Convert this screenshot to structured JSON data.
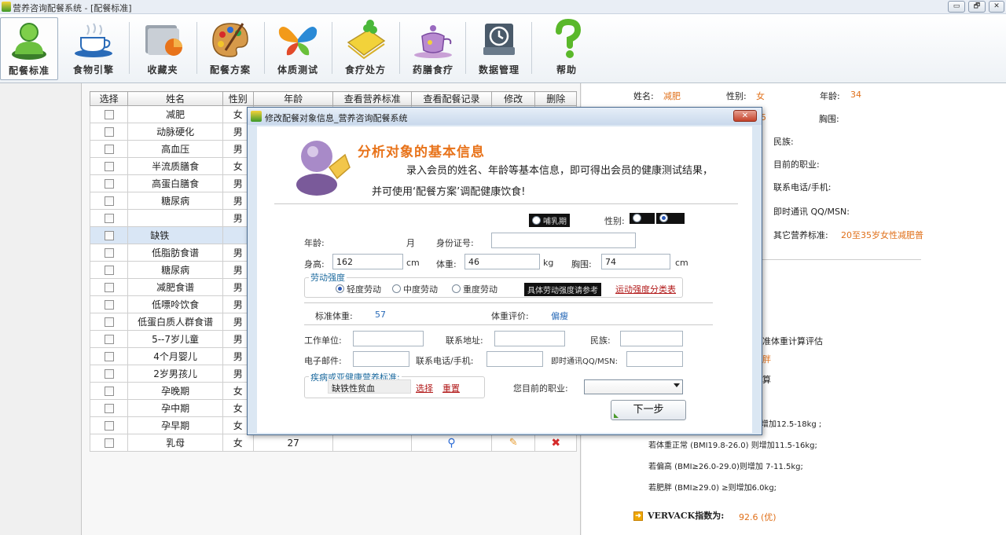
{
  "window": {
    "title": "营养咨询配餐系统 - [配餐标准]",
    "buttons": [
      "▭",
      "🗗",
      "✕"
    ]
  },
  "toolbar": {
    "items": [
      {
        "label": "配餐标准",
        "icon": "person-icon"
      },
      {
        "label": "食物引擎",
        "icon": "coffee-cup-icon"
      },
      {
        "label": "收藏夹",
        "icon": "folder-icon"
      },
      {
        "label": "配餐方案",
        "icon": "palette-icon"
      },
      {
        "label": "体质测试",
        "icon": "butterfly-icon"
      },
      {
        "label": "食疗处方",
        "icon": "notebook-clover-icon"
      },
      {
        "label": "药膳食疗",
        "icon": "teapot-icon"
      },
      {
        "label": "数据管理",
        "icon": "backup-drive-icon"
      },
      {
        "label": "帮助",
        "icon": "question-mark-icon"
      }
    ]
  },
  "grid": {
    "columns": [
      "选择",
      "姓名",
      "性别",
      "年龄",
      "查看营养标准",
      "查看配餐记录",
      "修改",
      "删除"
    ],
    "rows": [
      {
        "name": "减肥",
        "gender": "女"
      },
      {
        "name": "动脉硬化",
        "gender": "男"
      },
      {
        "name": "高血压",
        "gender": "男"
      },
      {
        "name": "半流质膳食",
        "gender": "女"
      },
      {
        "name": "高蛋白膳食",
        "gender": "男"
      },
      {
        "name": "糖尿病",
        "gender": "男"
      },
      {
        "name": "",
        "gender": "男"
      },
      {
        "name": "缺铁",
        "gender": ""
      },
      {
        "name": "低脂肪食谱",
        "gender": "男"
      },
      {
        "name": "糖尿病",
        "gender": "男"
      },
      {
        "name": "减肥食谱",
        "gender": "男"
      },
      {
        "name": "低嘌呤饮食",
        "gender": "男"
      },
      {
        "name": "低蛋白质人群食谱",
        "gender": "男"
      },
      {
        "name": "5--7岁儿童",
        "gender": "男"
      },
      {
        "name": "4个月婴儿",
        "gender": "男"
      },
      {
        "name": "2岁男孩儿",
        "gender": "男"
      },
      {
        "name": "孕晚期",
        "gender": "女"
      },
      {
        "name": "孕中期",
        "gender": "女"
      },
      {
        "name": "孕早期",
        "gender": "女"
      },
      {
        "name": "乳母",
        "gender": "女",
        "age": "27"
      }
    ]
  },
  "right": {
    "name_label": "姓名:",
    "name_value": "减肥",
    "gender_label": "性别:",
    "gender_value": "女",
    "age_label": "年龄:",
    "age_value": "34",
    "partial_value": "5",
    "chest_label": "胸围:",
    "ethnicity_label": "民族:",
    "occupation_label": "目前的职业:",
    "phone_label": "联系电话/手机:",
    "im_label": "即时通讯 QQ/MSN:",
    "other_label": "其它营养标准:",
    "other_value": "20至35岁女性减肥普",
    "calc_text": "准体重计算评估",
    "fat_text": "胖",
    "calc2_text": "算",
    "gain1": "增加12.5-18kg ;",
    "gain2": "若体重正常  (BMI19.8-26.0) 则增加11.5-16kg;",
    "gain3": "若偏高  (BMI≥26.0-29.0)则增加 7-11.5kg;",
    "gain4": "若肥胖   (BMI≥29.0) ≥则增加6.0kg;",
    "vervack_label": "VERVACK指数为:",
    "vervack_value": "92.6 (优)"
  },
  "dialog": {
    "title": "修改配餐对象信息_营养咨询配餐系统",
    "close": "✕",
    "heading": "分析对象的基本信息",
    "intro1": "录入会员的姓名、年龄等基本信息，即可得出会员的健康测试结果，",
    "intro2": "并可使用‘配餐方案’调配健康饮食!",
    "lactation": "哺乳期",
    "gender_label": "性别:",
    "age_label": "年龄:",
    "month_label": "月",
    "id_label": "身份证号:",
    "height_label": "身高:",
    "height_value": "162",
    "height_unit": "cm",
    "weight_label": "体重:",
    "weight_value": "46",
    "weight_unit": "kg",
    "chest_label": "胸围:",
    "chest_value": "74",
    "chest_unit": "cm",
    "labor_legend": "劳动强度",
    "labor_options": [
      "轻度劳动",
      "中度劳动",
      "重度劳动"
    ],
    "labor_ref": "具体劳动强度请参考",
    "labor_link": "运动强度分类表",
    "std_weight_label": "标准体重:",
    "std_weight_value": "57",
    "eval_label": "体重评价:",
    "eval_value": "偏瘦",
    "work_label": "工作单位:",
    "address_label": "联系地址:",
    "ethnicity_label": "民族:",
    "email_label": "电子邮件:",
    "phone_label": "联系电话/手机:",
    "im_label": "即时通讯QQ/MSN:",
    "disease_legend": "疾病或亚健康营养标准:",
    "disease_value": "缺铁性贫血",
    "select_link": "选择",
    "reset_link": "重置",
    "occupation_label": "您目前的职业:",
    "next_button": "下一步"
  },
  "colors": {
    "accent_orange": "#e8731a",
    "link_red": "#b21a1a",
    "selected_row": "#d9e6f5",
    "dialog_frame": "#dbe7f3"
  }
}
